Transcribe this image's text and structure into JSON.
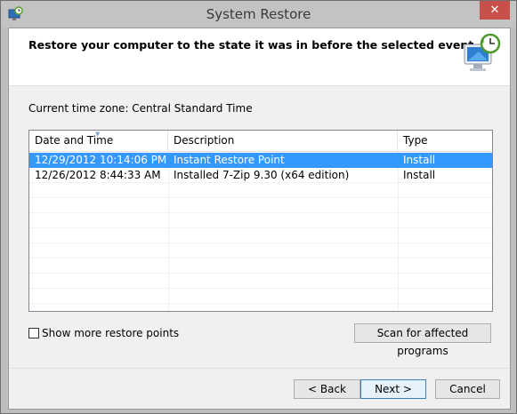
{
  "window": {
    "title": "System Restore",
    "close_label": "✕"
  },
  "header": {
    "text": "Restore your computer to the state it was in before the selected event"
  },
  "timezone": {
    "text": "Current time zone: Central Standard Time"
  },
  "table": {
    "columns": [
      "Date and Time",
      "Description",
      "Type"
    ],
    "rows": [
      {
        "date": "12/29/2012 10:14:06 PM",
        "description": "Instant Restore Point",
        "type": "Install",
        "selected": true
      },
      {
        "date": "12/26/2012 8:44:33 AM",
        "description": "Installed 7-Zip 9.30 (x64 edition)",
        "type": "Install",
        "selected": false
      }
    ]
  },
  "show_more": {
    "label": "Show more restore points",
    "checked": false
  },
  "buttons": {
    "scan": "Scan for affected programs",
    "back": "< Back",
    "next": "Next >",
    "cancel": "Cancel"
  },
  "colors": {
    "selection": "#3399ff",
    "close": "#c7504a"
  }
}
